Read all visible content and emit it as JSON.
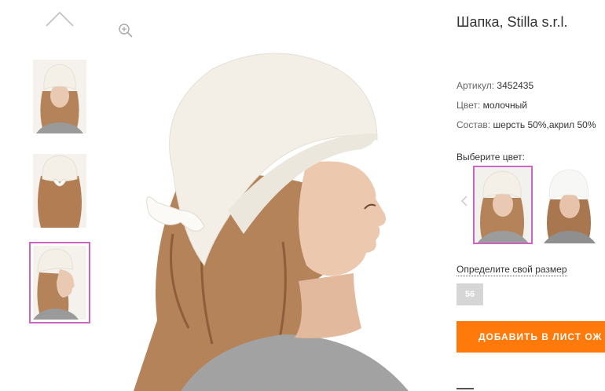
{
  "product": {
    "title": "Шапка, Stilla s.r.l.",
    "article_label": "Артикул:",
    "article_value": "3452435",
    "color_label": "Цвет:",
    "color_value": "молочный",
    "composition_label": "Состав:",
    "composition_value": "шерсть 50%,акрил 50%"
  },
  "color_picker": {
    "label": "Выберите цвет:"
  },
  "size": {
    "link_label": "Определите свой размер",
    "option": "56"
  },
  "cart": {
    "add_label": "ДОБАВИТЬ В ЛИСТ ОЖ"
  },
  "gallery": {
    "thumbnails": [
      "front-view",
      "back-view",
      "side-view"
    ],
    "selected_index": 2
  },
  "colors": {
    "accent": "#ff7a0a",
    "selection": "#cc66c2",
    "hat": "#f1ede4",
    "hair": "#b5835a"
  },
  "icons": {
    "thumbs_up": "chevron-up-icon",
    "zoom": "zoom-in-icon",
    "prev": "chevron-left-icon"
  }
}
